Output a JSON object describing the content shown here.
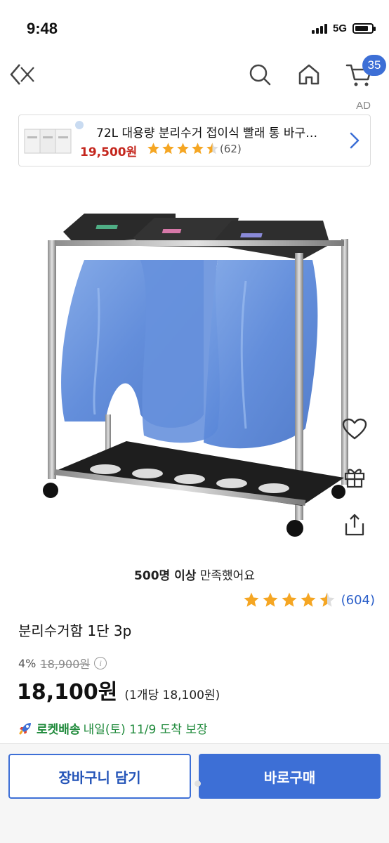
{
  "status_bar": {
    "time": "9:48",
    "network": "5G"
  },
  "nav": {
    "cart_count": "35"
  },
  "ad": {
    "label": "AD",
    "title": "72L 대용량 분리수거 접이식 빨래 통 바구…",
    "price": "19,500원",
    "rating": 4.5,
    "rating_count": "(62)"
  },
  "product": {
    "satisfaction_bold": "500명 이상",
    "satisfaction_rest": " 만족했어요",
    "rating": 4.5,
    "rating_count": "(604)",
    "name": "분리수거함 1단 3p",
    "discount": "4%",
    "original_price": "18,900원",
    "info_icon": "i",
    "sale_price": "18,100원",
    "unit_price": "(1개당 18,100원)"
  },
  "delivery": {
    "rocket_label": "로켓배송",
    "text": "내일(토) 11/9 도착 보장"
  },
  "actions": {
    "cart_label": "장바구니 담기",
    "buy_label": "바로구매"
  },
  "colors": {
    "accent": "#3d6fd6",
    "price_red": "#c4261d",
    "star": "#f5a623",
    "delivery_green": "#1f8a3b"
  },
  "icons": [
    "back-icon",
    "search-icon",
    "home-icon",
    "cart-icon",
    "heart-icon",
    "gift-icon",
    "share-icon",
    "chevron-right-icon",
    "rocket-icon"
  ]
}
